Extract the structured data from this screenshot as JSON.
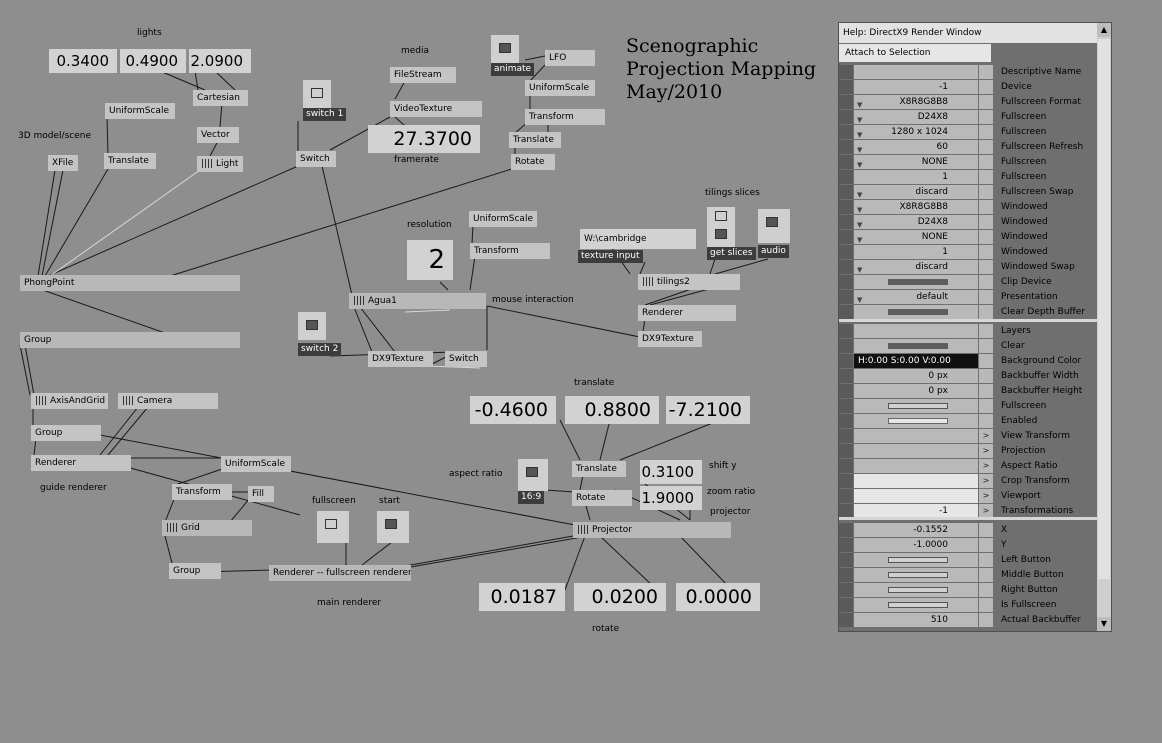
{
  "title_lines": [
    "Scenographic",
    "Projection Mapping",
    "May/2010"
  ],
  "labels": {
    "lights": "lights",
    "media": "media",
    "model": "3D model/scene",
    "framerate": "framerate",
    "resolution": "resolution",
    "mouse": "mouse interaction",
    "tilings": "tilings slices",
    "guide": "guide renderer",
    "fullscreen": "fullscreen",
    "start": "start",
    "main_renderer": "main renderer",
    "translate": "translate",
    "aspect": "aspect ratio",
    "shift": "shift y",
    "zoom": "zoom ratio",
    "projector": "projector",
    "rotate": "rotate"
  },
  "values": {
    "light_x": "0.3400",
    "light_y": "0.4900",
    "light_z": "2.0900",
    "framerate": "27.3700",
    "resolution": "2",
    "tx": "-0.4600",
    "ty": "0.8800",
    "tz": "-7.2100",
    "shift_y": "0.3100",
    "zoom": "1.9000",
    "rx": "0.0187",
    "ry": "0.0200",
    "rz": "0.0000"
  },
  "captions": {
    "animate": "animate",
    "switch1": "switch 1",
    "switch2": "switch 2",
    "texture_input": "texture input",
    "get_slices": "get slices",
    "audio": "audio",
    "aspect": "16:9"
  },
  "path_text": "W:\\cambridge",
  "nodes": {
    "uniformscale1": "UniformScale",
    "cartesian": "Cartesian",
    "vector": "Vector",
    "light": "|||| Light",
    "xfile": "XFile",
    "translate1": "Translate",
    "filestream": "FileStream",
    "videotexture": "VideoTexture",
    "lfo": "LFO",
    "uniformscale2": "UniformScale",
    "transform1": "Transform",
    "translate2": "Translate",
    "rotate1": "Rotate",
    "switch_a": "Switch",
    "phongpoint": "PhongPoint",
    "uniformscale3": "UniformScale",
    "transform2": "Transform",
    "agua": "|||| Agua1",
    "dx9tex1": "DX9Texture",
    "switch_b": "Switch",
    "tilings": "|||| tilings2",
    "renderer_t": "Renderer",
    "dx9tex2": "DX9Texture",
    "group1": "Group",
    "axis": "|||| AxisAndGrid",
    "camera": "|||| Camera",
    "group2": "Group",
    "renderer_g": "Renderer",
    "uniformscale4": "UniformScale",
    "transform3": "Transform",
    "fill": "Fill",
    "grid": "|||| Grid",
    "group3": "Group",
    "renderer_main": "Renderer -- fullscreen renderer",
    "translate3": "Translate",
    "rotate2": "Rotate",
    "projector": "|||| Projector"
  },
  "help": {
    "title": "Help: DirectX9 Render Window",
    "attach": "Attach to Selection",
    "rows": [
      {
        "value": "",
        "name": "Descriptive Name"
      },
      {
        "value": "-1",
        "name": "Device"
      },
      {
        "value": "X8R8G8B8",
        "name": "Fullscreen Format",
        "dd": true
      },
      {
        "value": "D24X8",
        "name": "Fullscreen",
        "dd": true
      },
      {
        "value": "1280 x 1024",
        "name": "Fullscreen",
        "dd": true
      },
      {
        "value": "60",
        "name": "Fullscreen Refresh",
        "dd": true
      },
      {
        "value": "NONE",
        "name": "Fullscreen",
        "dd": true
      },
      {
        "value": "1",
        "name": "Fullscreen"
      },
      {
        "value": "discard",
        "name": "Fullscreen Swap",
        "dd": true
      },
      {
        "value": "X8R8G8B8",
        "name": "Windowed",
        "dd": true
      },
      {
        "value": "D24X8",
        "name": "Windowed",
        "dd": true
      },
      {
        "value": "NONE",
        "name": "Windowed",
        "dd": true
      },
      {
        "value": "1",
        "name": "Windowed"
      },
      {
        "value": "discard",
        "name": "Windowed Swap",
        "dd": true
      },
      {
        "value": "",
        "name": "Clip Device",
        "bar": "dark"
      },
      {
        "value": "default",
        "name": "Presentation",
        "dd": true
      },
      {
        "value": "",
        "name": "Clear Depth Buffer",
        "bar": "dark"
      }
    ],
    "rows2": [
      {
        "value": "",
        "name": "Layers"
      },
      {
        "value": "",
        "name": "Clear",
        "bar": "dark"
      },
      {
        "value": "H:0.00  S:0.00  V:0.00",
        "name": "Background Color",
        "color": true
      },
      {
        "value": "0 px",
        "name": "Backbuffer Width"
      },
      {
        "value": "0 px",
        "name": "Backbuffer Height"
      },
      {
        "value": "",
        "name": "Fullscreen",
        "bar": "hollow"
      },
      {
        "value": "",
        "name": "Enabled",
        "bar": "lit"
      },
      {
        "value": "",
        "name": "View Transform",
        "arrow": true
      },
      {
        "value": "",
        "name": "Projection",
        "arrow": true
      },
      {
        "value": "",
        "name": "Aspect Ratio",
        "arrow": true
      },
      {
        "value": "",
        "name": "Crop Transform",
        "arrow": true,
        "light": true
      },
      {
        "value": "",
        "name": "Viewport",
        "arrow": true,
        "light": true
      },
      {
        "value": "-1",
        "name": "Transformations",
        "arrow": true,
        "light": true
      }
    ],
    "rows3": [
      {
        "value": "-0.1552",
        "name": "X"
      },
      {
        "value": "-1.0000",
        "name": "Y"
      },
      {
        "value": "",
        "name": "Left Button",
        "bar": "hollow"
      },
      {
        "value": "",
        "name": "Middle Button",
        "bar": "hollow"
      },
      {
        "value": "",
        "name": "Right Button",
        "bar": "hollow"
      },
      {
        "value": "",
        "name": "Is Fullscreen",
        "bar": "hollow"
      },
      {
        "value": "510",
        "name": "Actual Backbuffer"
      }
    ]
  }
}
